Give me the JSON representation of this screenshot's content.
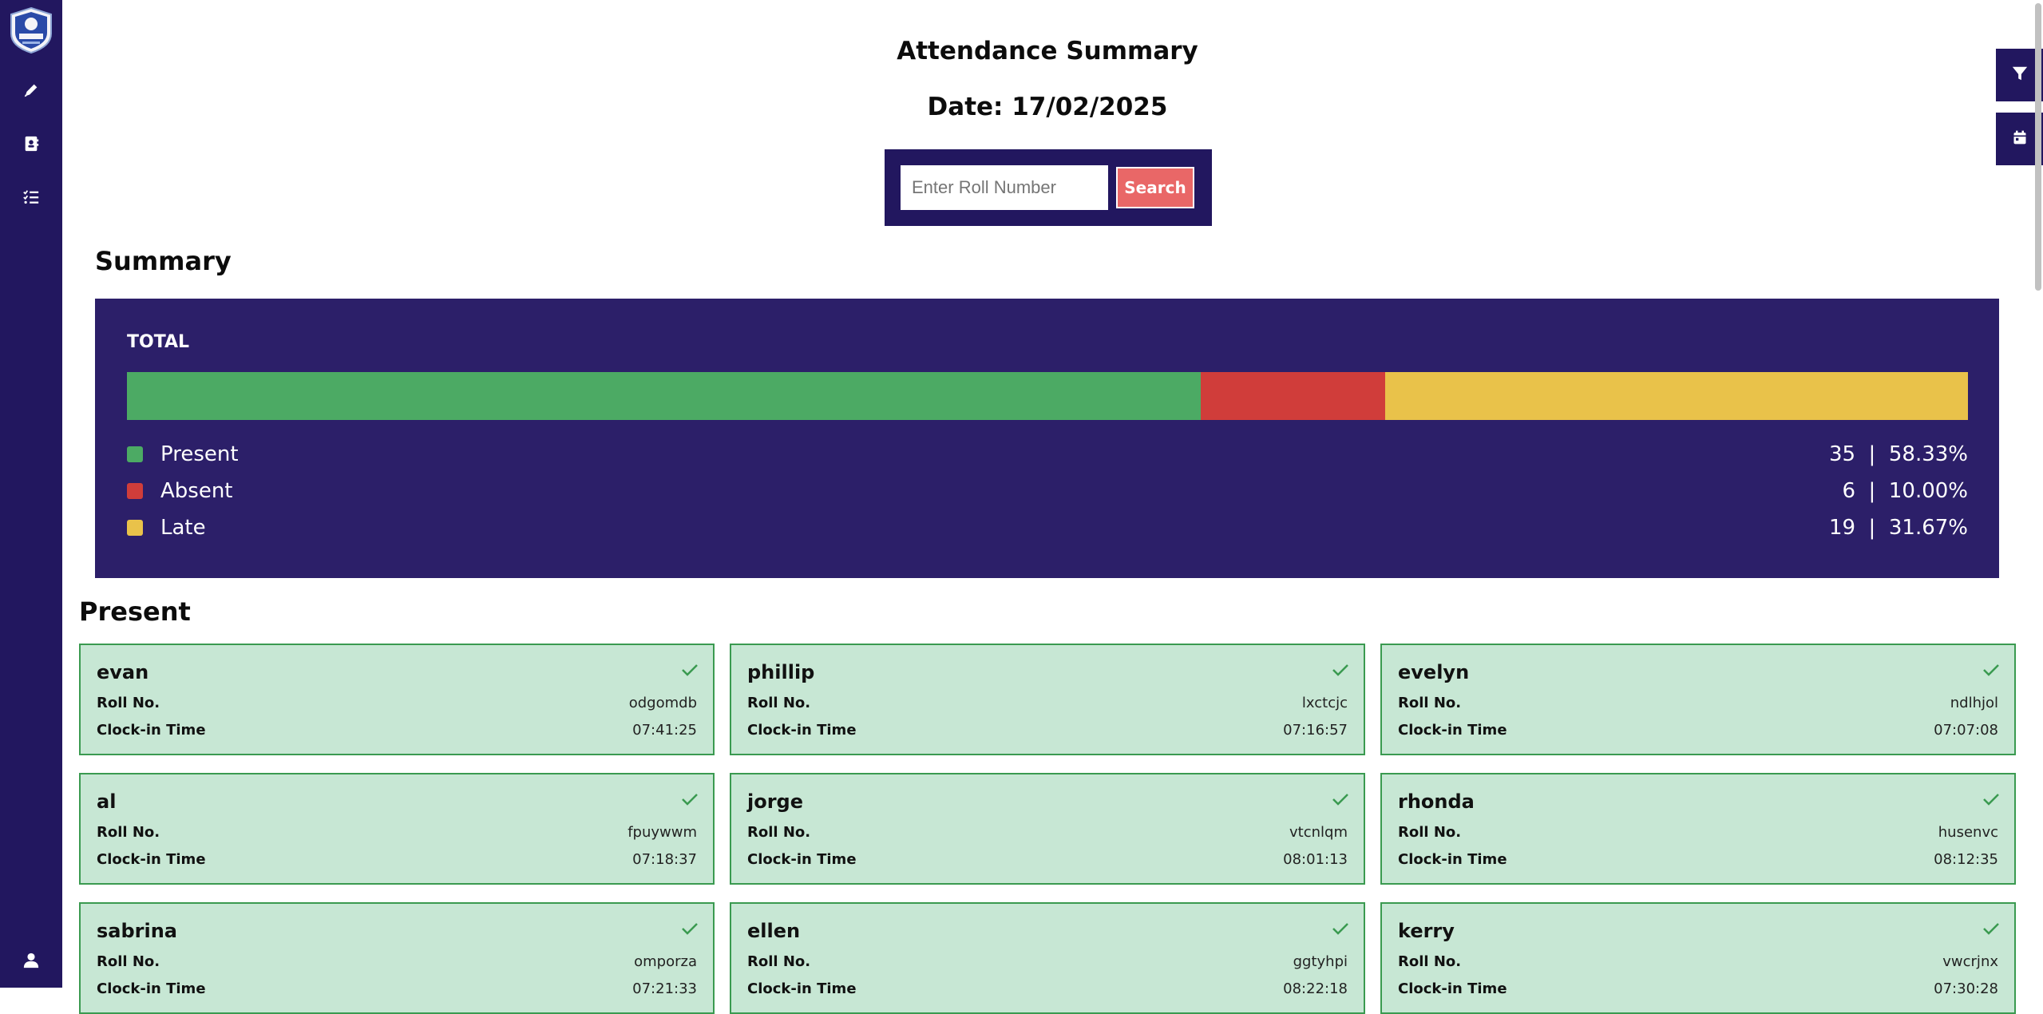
{
  "header": {
    "title": "Attendance Summary",
    "date": "Date: 17/02/2025"
  },
  "search": {
    "placeholder": "Enter Roll Number",
    "button_label": "Search"
  },
  "summary": {
    "heading": "Summary",
    "total_label": "TOTAL",
    "items": [
      {
        "label": "Present",
        "count": "35",
        "percent": "58.33%",
        "fraction": 0.5833,
        "color": "#4caa64"
      },
      {
        "label": "Absent",
        "count": "6",
        "percent": "10.00%",
        "fraction": 0.1,
        "color": "#d03d3a"
      },
      {
        "label": "Late",
        "count": "19",
        "percent": "31.67%",
        "fraction": 0.3167,
        "color": "#e9c24a"
      }
    ]
  },
  "present": {
    "heading": "Present",
    "roll_label": "Roll No.",
    "clock_label": "Clock-in Time",
    "students": [
      {
        "name": "evan",
        "roll": "odgomdb",
        "time": "07:41:25"
      },
      {
        "name": "phillip",
        "roll": "lxctcjc",
        "time": "07:16:57"
      },
      {
        "name": "evelyn",
        "roll": "ndlhjol",
        "time": "07:07:08"
      },
      {
        "name": "al",
        "roll": "fpuywwm",
        "time": "07:18:37"
      },
      {
        "name": "jorge",
        "roll": "vtcnlqm",
        "time": "08:01:13"
      },
      {
        "name": "rhonda",
        "roll": "husenvc",
        "time": "08:12:35"
      },
      {
        "name": "sabrina",
        "roll": "omporza",
        "time": "07:21:33"
      },
      {
        "name": "ellen",
        "roll": "ggtyhpi",
        "time": "08:22:18"
      },
      {
        "name": "kerry",
        "roll": "vwcrjnx",
        "time": "07:30:28"
      }
    ]
  },
  "colors": {
    "sidebar": "#22175f",
    "panel": "#2c1f69",
    "card_bg": "#c7e7d4",
    "card_border": "#3a9a50",
    "search_button": "#e96767"
  },
  "icons": {
    "sidebar": [
      "pen-icon",
      "contact-book-icon",
      "checklist-icon",
      "user-icon"
    ],
    "right": [
      "filter-icon",
      "calendar-icon"
    ]
  }
}
